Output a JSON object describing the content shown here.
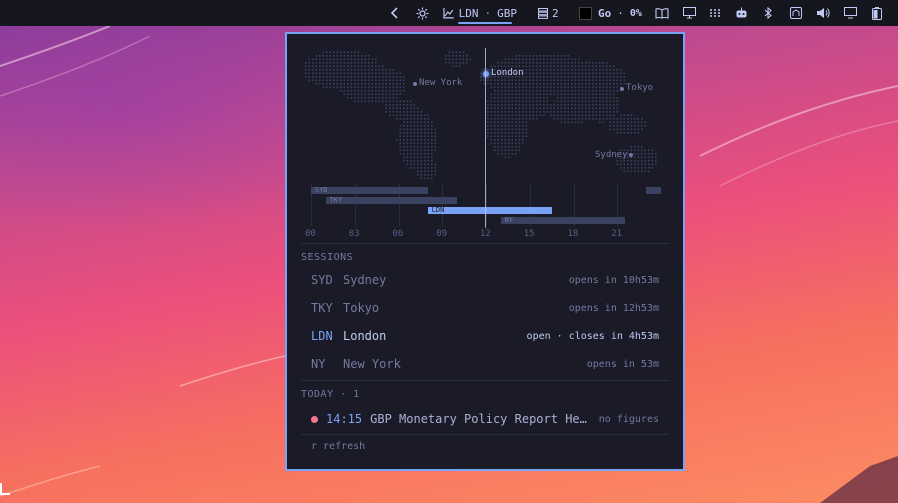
{
  "topbar": {
    "market_label": "LDN",
    "currency_label": "GBP",
    "workspace_count": "2",
    "go_label": "Go",
    "go_value": "0%"
  },
  "map": {
    "cities": [
      {
        "name": "New York",
        "active": false
      },
      {
        "name": "London",
        "active": true
      },
      {
        "name": "Tokyo",
        "active": false
      },
      {
        "name": "Sydney",
        "active": false
      }
    ]
  },
  "timeline": {
    "ticks": [
      "00",
      "03",
      "06",
      "09",
      "12",
      "15",
      "18",
      "21"
    ],
    "current_hour": 11.9,
    "bars": [
      {
        "label": "SYD",
        "start": 0,
        "end": 8,
        "active": false
      },
      {
        "label": "SYD",
        "start": 23,
        "end": 24,
        "active": false
      },
      {
        "label": "TKY",
        "start": 1,
        "end": 10,
        "active": false
      },
      {
        "label": "LDN",
        "start": 8,
        "end": 16.5,
        "active": true
      },
      {
        "label": "NY",
        "start": 13,
        "end": 21.5,
        "active": false
      }
    ]
  },
  "sessions": {
    "title": "SESSIONS",
    "items": [
      {
        "code": "SYD",
        "name": "Sydney",
        "status": "opens in 10h53m",
        "active": false
      },
      {
        "code": "TKY",
        "name": "Tokyo",
        "status": "opens in 12h53m",
        "active": false
      },
      {
        "code": "LDN",
        "name": "London",
        "status": "open · closes in 4h53m",
        "active": true
      },
      {
        "code": "NY",
        "name": "New York",
        "status": "opens in 53m",
        "active": false
      }
    ]
  },
  "today": {
    "title": "TODAY · 1",
    "events": [
      {
        "time": "14:15",
        "title": "GBP Monetary Policy Report He…",
        "status": "no figures",
        "dot_color": "#f7768e"
      }
    ]
  },
  "footer": {
    "hint": "r refresh"
  },
  "colors": {
    "accent": "#7aa2f7",
    "panel_bg": "#1a1b26",
    "muted": "#737aa2"
  }
}
